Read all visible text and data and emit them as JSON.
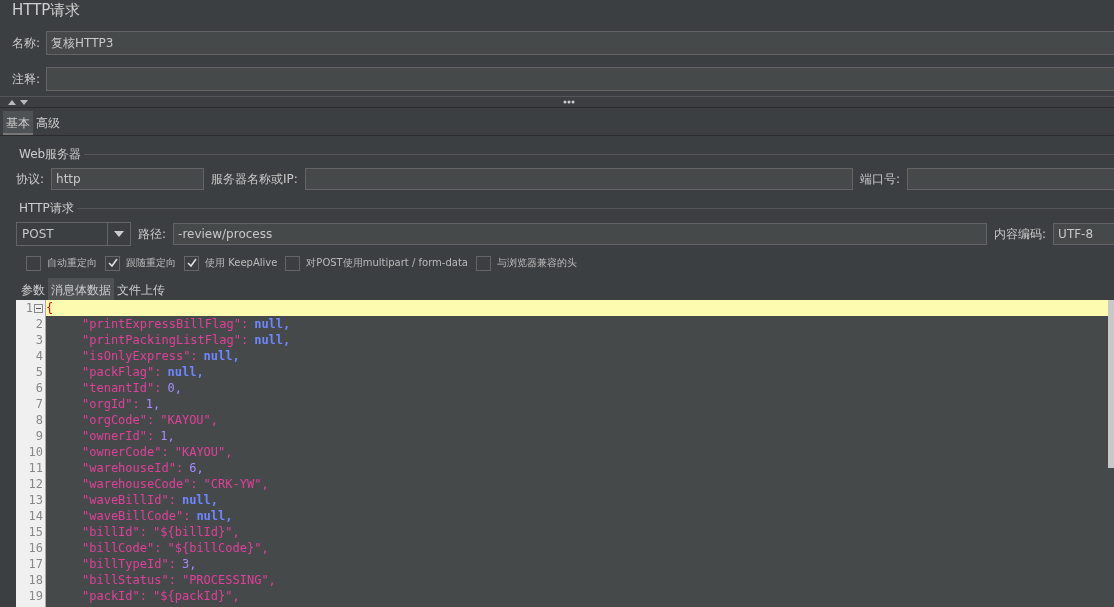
{
  "title": "HTTP请求",
  "name_field": {
    "label": "名称:",
    "value": "复核HTTP3"
  },
  "comment_field": {
    "label": "注释:"
  },
  "tabs": [
    {
      "label": "基本",
      "selected": true
    },
    {
      "label": "高级",
      "selected": false
    }
  ],
  "web_server": {
    "legend": "Web服务器",
    "protocol": {
      "label": "协议:",
      "value": "http"
    },
    "server": {
      "label": "服务器名称或IP:"
    },
    "port": {
      "label": "端口号:"
    }
  },
  "http_request": {
    "legend": "HTTP请求",
    "method": "POST",
    "path": {
      "label": "路径:",
      "value": "-review/process"
    },
    "encoding": {
      "label": "内容编码:",
      "value": "UTF-8"
    }
  },
  "options": [
    {
      "label": "自动重定向",
      "checked": false
    },
    {
      "label": "跟随重定向",
      "checked": true
    },
    {
      "label": "使用 KeepAlive",
      "checked": true
    },
    {
      "label": "对POST使用multipart / form-data",
      "checked": false
    },
    {
      "label": "与浏览器兼容的头",
      "checked": false
    }
  ],
  "body_tabs": [
    {
      "label": "参数",
      "selected": false
    },
    {
      "label": "消息体数据",
      "selected": true
    },
    {
      "label": "文件上传",
      "selected": false
    }
  ],
  "code_lines": [
    {
      "number": "1",
      "kind": "open",
      "text": "{",
      "current": true
    },
    {
      "number": "2",
      "kind": "null",
      "key": "\"printExpressBillFlag\":",
      "value": "null,"
    },
    {
      "number": "3",
      "kind": "null",
      "key": "\"printPackingListFlag\":",
      "value": "null,"
    },
    {
      "number": "4",
      "kind": "null",
      "key": "\"isOnlyExpress\":",
      "value": "null,"
    },
    {
      "number": "5",
      "kind": "null",
      "key": "\"packFlag\":",
      "value": "null,"
    },
    {
      "number": "6",
      "kind": "number",
      "key": "\"tenantId\":",
      "value": "0,"
    },
    {
      "number": "7",
      "kind": "number",
      "key": "\"orgId\":",
      "value": "1,"
    },
    {
      "number": "8",
      "kind": "string",
      "key": "\"orgCode\":",
      "value": "\"KAYOU\","
    },
    {
      "number": "9",
      "kind": "number",
      "key": "\"ownerId\":",
      "value": "1,"
    },
    {
      "number": "10",
      "kind": "string",
      "key": "\"ownerCode\":",
      "value": "\"KAYOU\","
    },
    {
      "number": "11",
      "kind": "number",
      "key": "\"warehouseId\":",
      "value": "6,"
    },
    {
      "number": "12",
      "kind": "string",
      "key": "\"warehouseCode\":",
      "value": "\"CRK-YW\","
    },
    {
      "number": "13",
      "kind": "null",
      "key": "\"waveBillId\":",
      "value": "null,"
    },
    {
      "number": "14",
      "kind": "null",
      "key": "\"waveBillCode\":",
      "value": "null,"
    },
    {
      "number": "15",
      "kind": "string",
      "key": "\"billId\":",
      "value": "\"${billId}\","
    },
    {
      "number": "16",
      "kind": "string",
      "key": "\"billCode\":",
      "value": "\"${billCode}\","
    },
    {
      "number": "17",
      "kind": "number",
      "key": "\"billTypeId\":",
      "value": "3,"
    },
    {
      "number": "18",
      "kind": "string",
      "key": "\"billStatus\":",
      "value": "\"PROCESSING\","
    },
    {
      "number": "19",
      "kind": "string",
      "key": "\"packId\":",
      "value": "\"${packId}\","
    }
  ]
}
